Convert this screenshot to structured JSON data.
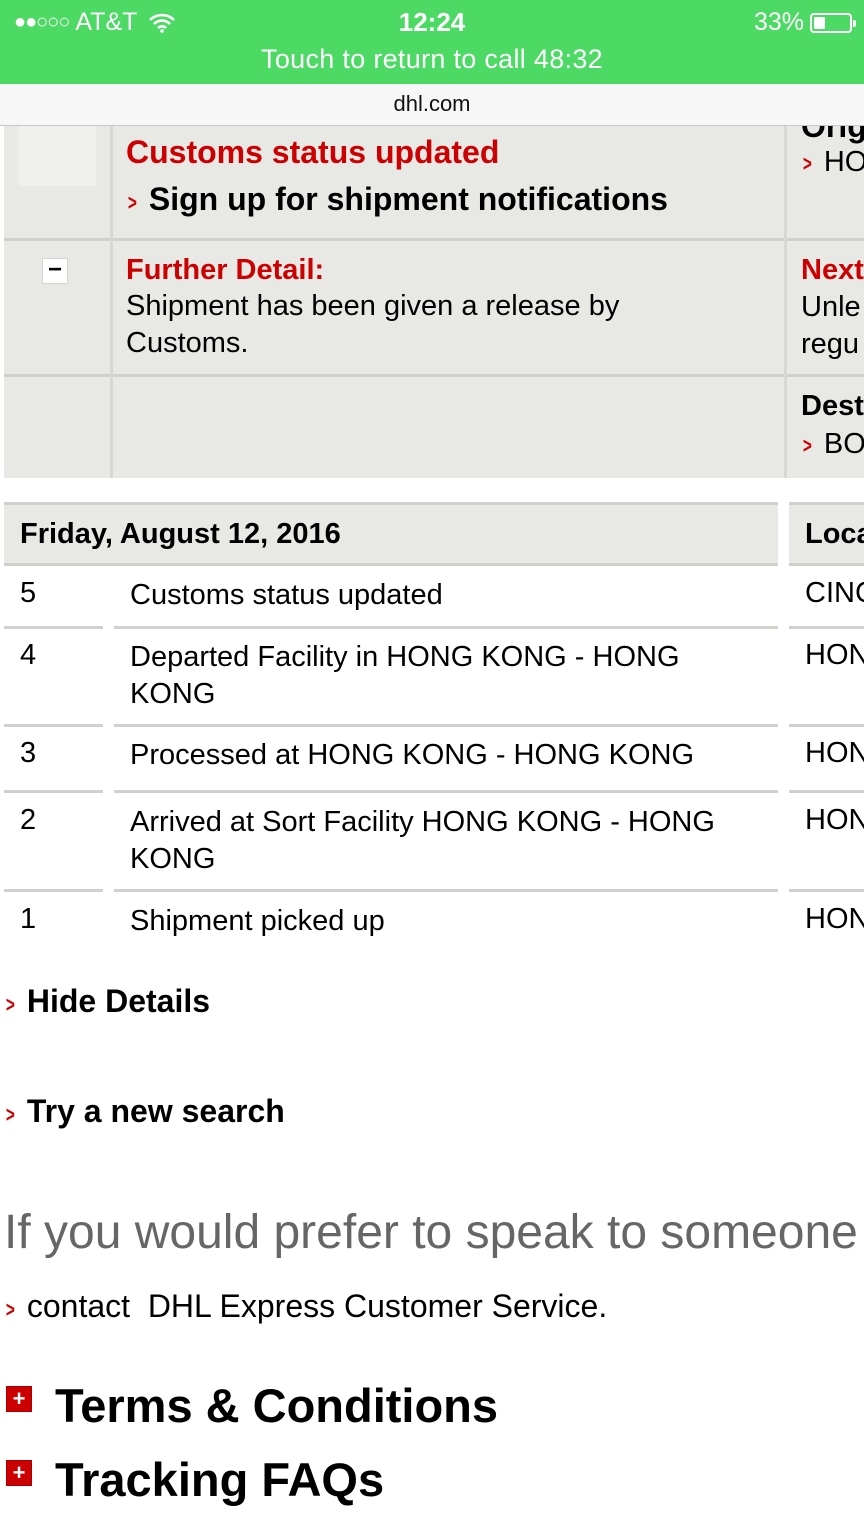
{
  "status_bar": {
    "signal_dots": "●●○○○",
    "carrier": "AT&T",
    "time": "12:24",
    "battery_percent": "33%",
    "battery_level": 0.33,
    "call_banner": "Touch to return to call 48:32"
  },
  "url_bar": {
    "domain": "dhl.com"
  },
  "summary": {
    "status_title": "Customs status updated",
    "notifications_link": "Sign up for shipment notifications",
    "further_detail_label": "Further Detail:",
    "further_detail_text": "Shipment has been given a release by Customs.",
    "collapse_symbol": "−",
    "right_column": {
      "origin_label": "Orig",
      "origin_value": "HO",
      "next_label": "Next",
      "next_text_line1": "Unle",
      "next_text_line2": "regu",
      "destination_label": "Dest",
      "destination_value": "BO"
    }
  },
  "events_table": {
    "date_header": "Friday, August 12, 2016",
    "location_header": "Loca",
    "rows": [
      {
        "num": "5",
        "description": "Customs status updated",
        "location": "CINC"
      },
      {
        "num": "4",
        "description": "Departed Facility in HONG KONG - HONG KONG",
        "location": "HON"
      },
      {
        "num": "3",
        "description": "Processed at HONG KONG - HONG KONG",
        "location": "HON"
      },
      {
        "num": "2",
        "description": "Arrived at Sort Facility HONG KONG - HONG KONG",
        "location": "HON"
      },
      {
        "num": "1",
        "description": "Shipment picked up",
        "location": "HON"
      }
    ]
  },
  "links": {
    "hide_details": "Hide Details",
    "new_search": "Try a new search",
    "prefer_text": "If you would prefer to speak to someone",
    "contact_prefix": "contact",
    "contact_link": "DHL Express Customer Service",
    "contact_suffix": "."
  },
  "sections": {
    "terms": "Terms & Conditions",
    "faqs": "Tracking FAQs",
    "expand_symbol": "+"
  },
  "colors": {
    "status_green": "#4cd964",
    "dhl_red": "#cc0000",
    "panel_gray": "#e8e8e5"
  },
  "icons": [
    "wifi-icon",
    "battery-icon",
    "caret-right-icon",
    "minus-icon",
    "plus-icon"
  ]
}
